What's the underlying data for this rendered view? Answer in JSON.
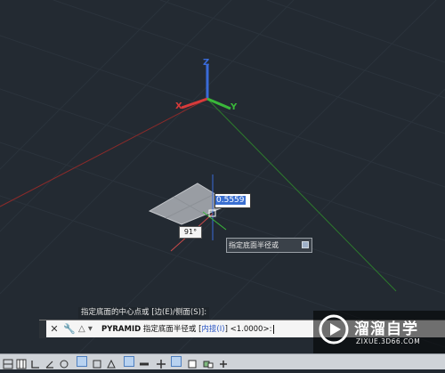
{
  "viewport": {
    "axis_labels": {
      "z": "Z",
      "x": "X",
      "y": "Y"
    }
  },
  "dynamic_input": {
    "value": "0.5559"
  },
  "angle_readout": {
    "value": "91°"
  },
  "tooltip": {
    "text": "指定底面半径或"
  },
  "command_history": {
    "text": "指定底面的中心点或 [边(E)/侧面(S)]:"
  },
  "command_line": {
    "close_glyph": "✕",
    "settings_glyph": "🔧",
    "icon_glyph": "△ ▾",
    "command": "PYRAMID",
    "prompt": " 指定底面半径或 [",
    "option": "内接(I)",
    "suffix": "] <1.0000>:"
  },
  "watermark": {
    "name": "溜溜自学",
    "url": "ZIXUE.3D66.COM"
  },
  "status_bar": {
    "icons": [
      "snap-icon",
      "grid-display-icon",
      "ortho-icon",
      "polar-icon",
      "osnap-icon",
      "3d-osnap-icon",
      "otrack-icon",
      "ducs-icon",
      "dyn-icon",
      "lineweight-icon",
      "transparency-icon",
      "quick-properties-icon",
      "selection-cycling-icon",
      "annotation-monitor-icon"
    ]
  }
}
